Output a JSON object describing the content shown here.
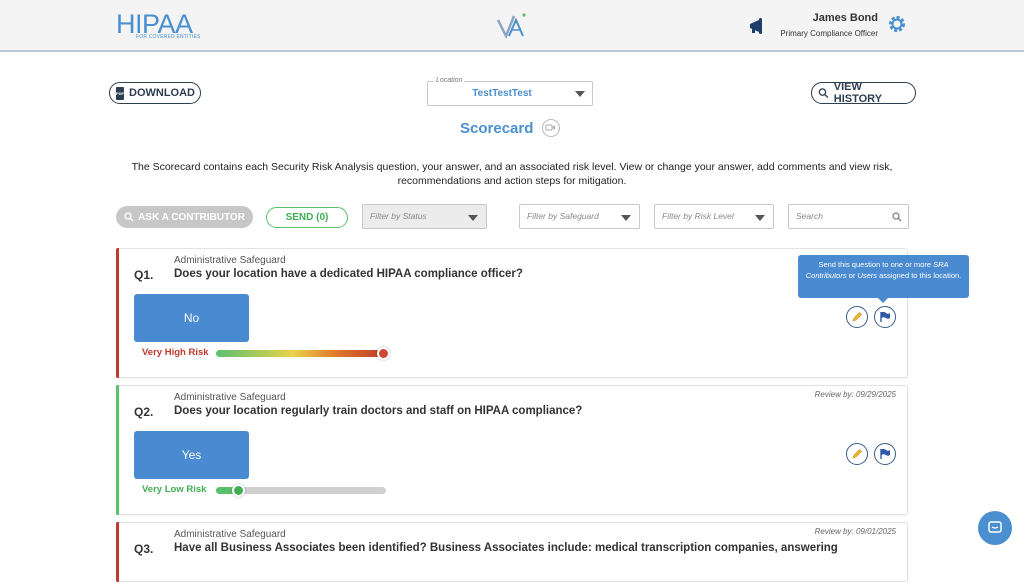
{
  "header": {
    "brand": "HIPAA",
    "brand_sub": "FOR COVERED ENTITIES",
    "user_name": "James Bond",
    "user_role": "Primary Compliance Officer",
    "icons": [
      "megaphone-icon",
      "gear-icon"
    ]
  },
  "toolbar": {
    "download_label": "DOWNLOAD",
    "pdf_badge": "PDF",
    "view_history_label": "VIEW HISTORY",
    "location_label": "Location",
    "location_value": "TestTestTest"
  },
  "page": {
    "title": "Scorecard",
    "intro": "The Scorecard contains each Security Risk Analysis question, your answer, and an associated risk level. View or change your answer, add comments and view risk, recommendations and action steps for mitigation."
  },
  "actions": {
    "ask_label": "ASK A CONTRIBUTOR",
    "send_label": "SEND (0)"
  },
  "filters": {
    "status_placeholder": "Filter by Status",
    "safeguard_placeholder": "Filter by Safeguard",
    "risk_placeholder": "Filter by Risk Level",
    "search_placeholder": "Search"
  },
  "tooltip": {
    "line1": "Send this question to one or more ",
    "em1": "SRA Contributors",
    "mid": " or ",
    "em2": "Users",
    "line2": " assigned to this location."
  },
  "questions": [
    {
      "number": "Q1.",
      "safeguard": "Administrative Safeguard",
      "text": "Does your location have a dedicated HIPAA compliance officer?",
      "review": "",
      "answer": "No",
      "risk_label": "Very High Risk",
      "risk_level": 0.98,
      "risk_color": "#c0392b"
    },
    {
      "number": "Q2.",
      "safeguard": "Administrative Safeguard",
      "text": "Does your location regularly train doctors and staff on HIPAA compliance?",
      "review": "Review by: 09/29/2025",
      "answer": "Yes",
      "risk_label": "Very Low Risk",
      "risk_level": 0.13,
      "risk_color": "#3fae53"
    },
    {
      "number": "Q3.",
      "safeguard": "Administrative Safeguard",
      "text": "Have all Business Associates been identified? Business Associates include: medical transcription companies, answering",
      "review": "Review by: 09/01/2025",
      "answer": "",
      "risk_label": "",
      "risk_level": null,
      "risk_color": "#c0392b"
    }
  ]
}
